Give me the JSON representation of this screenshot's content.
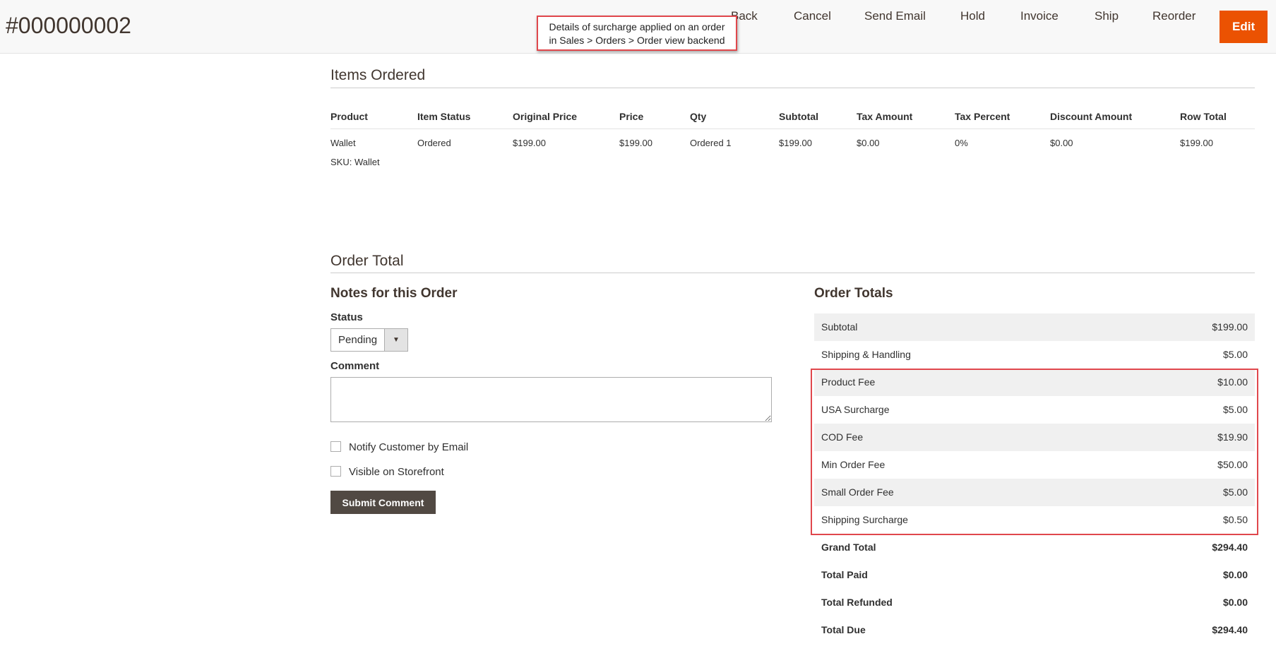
{
  "header": {
    "order_id": "#000000002",
    "actions": [
      "Back",
      "Cancel",
      "Send Email",
      "Hold",
      "Invoice",
      "Ship",
      "Reorder"
    ],
    "edit_label": "Edit"
  },
  "callout": {
    "line1": "Details of surcharge applied on an order",
    "line2": "in Sales > Orders > Order view backend"
  },
  "items_ordered": {
    "title": "Items Ordered",
    "columns": [
      "Product",
      "Item Status",
      "Original Price",
      "Price",
      "Qty",
      "Subtotal",
      "Tax Amount",
      "Tax Percent",
      "Discount Amount",
      "Row Total"
    ],
    "rows": [
      {
        "product": "Wallet",
        "sku": "SKU: Wallet",
        "item_status": "Ordered",
        "original_price": "$199.00",
        "price": "$199.00",
        "qty": "Ordered 1",
        "subtotal": "$199.00",
        "tax_amount": "$0.00",
        "tax_percent": "0%",
        "discount_amount": "$0.00",
        "row_total": "$199.00"
      }
    ]
  },
  "order_total": {
    "title": "Order Total",
    "notes": {
      "title": "Notes for this Order",
      "status_label": "Status",
      "status_value": "Pending",
      "comment_label": "Comment",
      "notify_label": "Notify Customer by Email",
      "visible_label": "Visible on Storefront",
      "submit_label": "Submit Comment"
    },
    "totals": {
      "title": "Order Totals",
      "rows": [
        {
          "label": "Subtotal",
          "value": "$199.00"
        },
        {
          "label": "Shipping & Handling",
          "value": "$5.00"
        },
        {
          "label": "Product Fee",
          "value": "$10.00"
        },
        {
          "label": "USA Surcharge",
          "value": "$5.00"
        },
        {
          "label": "COD Fee",
          "value": "$19.90"
        },
        {
          "label": "Min Order Fee",
          "value": "$50.00"
        },
        {
          "label": "Small Order Fee",
          "value": "$5.00"
        },
        {
          "label": "Shipping Surcharge",
          "value": "$0.50"
        }
      ],
      "summary": [
        {
          "label": "Grand Total",
          "value": "$294.40"
        },
        {
          "label": "Total Paid",
          "value": "$0.00"
        },
        {
          "label": "Total Refunded",
          "value": "$0.00"
        },
        {
          "label": "Total Due",
          "value": "$294.40"
        }
      ]
    }
  },
  "colors": {
    "accent": "#eb5202",
    "highlight": "#e0474c",
    "submit_bg": "#514943"
  }
}
